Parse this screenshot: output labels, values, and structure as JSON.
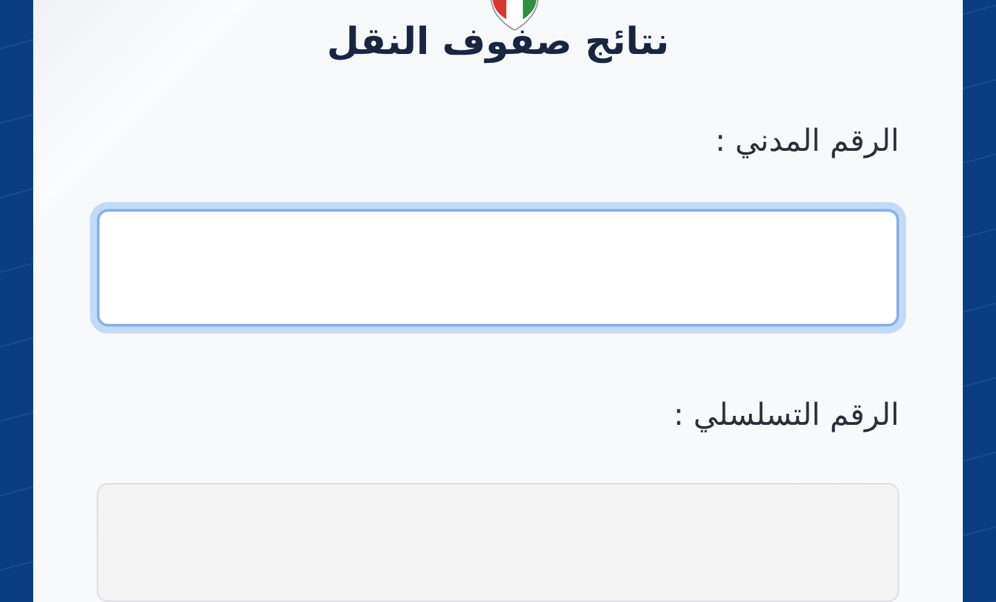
{
  "title": "نتائج صفوف النقل",
  "fields": [
    {
      "label": "الرقم المدني :",
      "focused": true,
      "disabled": false
    },
    {
      "label": "الرقم التسلسلي :",
      "focused": false,
      "disabled": true
    }
  ]
}
